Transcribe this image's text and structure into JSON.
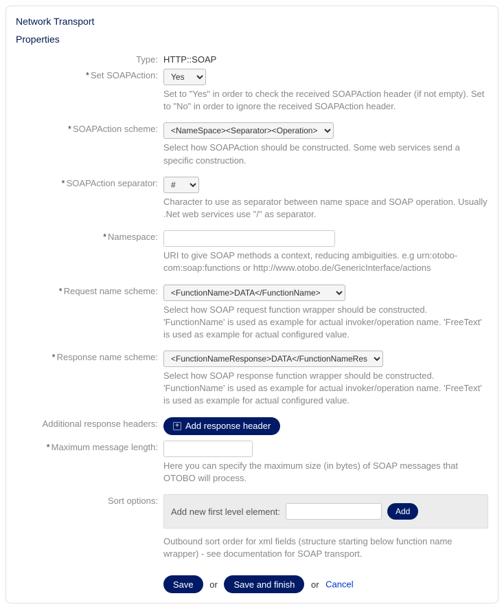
{
  "panel_title": "Network Transport",
  "properties_title": "Properties",
  "fields": {
    "type": {
      "label": "Type:",
      "value": "HTTP::SOAP"
    },
    "set_soapaction": {
      "label": "Set SOAPAction:",
      "value": "Yes",
      "help": "Set to \"Yes\" in order to check the received SOAPAction header (if not empty).\nSet to \"No\" in order to ignore the received SOAPAction header."
    },
    "soapaction_scheme": {
      "label": "SOAPAction scheme:",
      "value": "<NameSpace><Separator><Operation>",
      "help": "Select how SOAPAction should be constructed.\nSome web services send a specific construction."
    },
    "soapaction_separator": {
      "label": "SOAPAction separator:",
      "value": "#",
      "help": "Character to use as separator between name space and SOAP operation.\nUsually .Net web services use \"/\" as separator."
    },
    "namespace": {
      "label": "Namespace:",
      "value": "",
      "help": "URI to give SOAP methods a context, reducing ambiguities.\ne.g urn:otobo-com:soap:functions or http://www.otobo.de/GenericInterface/actions"
    },
    "request_name_scheme": {
      "label": "Request name scheme:",
      "value": "<FunctionName>DATA</FunctionName>",
      "help": "Select how SOAP request function wrapper should be constructed.\n'FunctionName' is used as example for actual invoker/operation name.\n'FreeText' is used as example for actual configured value."
    },
    "response_name_scheme": {
      "label": "Response name scheme:",
      "value": "<FunctionNameResponse>DATA</FunctionNameResponse>",
      "help": "Select how SOAP response function wrapper should be constructed.\n'FunctionName' is used as example for actual invoker/operation name.\n'FreeText' is used as example for actual configured value."
    },
    "additional_headers": {
      "label": "Additional response headers:",
      "button": "Add response header"
    },
    "max_message_length": {
      "label": "Maximum message length:",
      "value": "",
      "help": "Here you can specify the maximum size (in bytes) of SOAP messages that OTOBO will process."
    },
    "sort_options": {
      "label": "Sort options:",
      "inner_label": "Add new first level element:",
      "input": "",
      "add_button": "Add",
      "help": "Outbound sort order for xml fields (structure starting below function name wrapper) - see documentation for SOAP transport."
    }
  },
  "actions": {
    "save": "Save",
    "or1": "or",
    "save_finish": "Save and finish",
    "or2": "or",
    "cancel": "Cancel"
  }
}
